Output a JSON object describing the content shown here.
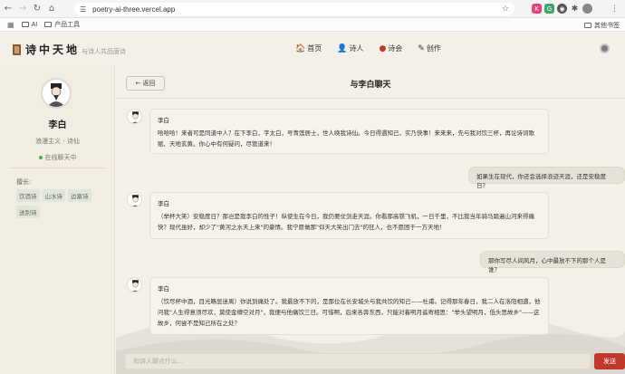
{
  "browser": {
    "url": "poetry-ai-three.vercel.app",
    "bookmarks": [
      {
        "label": "AI"
      },
      {
        "label": "产品工具"
      }
    ],
    "other_bookmarks": "其他书签",
    "extensions": [
      {
        "icon": "kagi-icon",
        "color": "#e0457b"
      },
      {
        "icon": "grammarly-icon",
        "color": "#3fa46a"
      },
      {
        "icon": "github-icon",
        "color": "#555555"
      },
      {
        "icon": "extension-icon",
        "color": "#777777"
      },
      {
        "icon": "profile-icon",
        "color": "#777777"
      }
    ]
  },
  "header": {
    "logo": "诗中天地",
    "tagline": "与诗人共品唐诗",
    "nav": [
      {
        "icon": "home-icon",
        "label": "首页"
      },
      {
        "icon": "poet-icon",
        "label": "诗人"
      },
      {
        "icon": "lantern-icon",
        "label": "诗会"
      },
      {
        "icon": "brush-icon",
        "label": "创作"
      }
    ]
  },
  "sidebar": {
    "name": "李白",
    "style": "浪漫主义 · 诗仙",
    "status": "在线聊天中",
    "skills_label": "擅长:",
    "tags": [
      "饮酒诗",
      "山水诗",
      "边塞诗",
      "送别诗"
    ]
  },
  "chat": {
    "back": "← 返回",
    "title": "与李白聊天",
    "messages": [
      {
        "role": "poet",
        "name": "李白",
        "text": "哈哈哈！来者可是同道中人？在下李白，字太白，号青莲居士，世人唤我诗仙。今日得遇知己，实乃快事！来来来，先与我对饮三杯，再论诗词歌赋、天地玄黄。你心中有何疑问，尽管道来！"
      },
      {
        "role": "user",
        "text": "如果生在现代，你还会选择浪迹天涯，还是安稳度日？"
      },
      {
        "role": "poet",
        "name": "李白",
        "text": "（举杯大笑）安稳度日？那岂是我李白的性子！纵使生在今日，我仍要仗剑走天涯。你看那高铁飞机，一日千里，不比我当年骑马踏遍山河来得痛快？现代虽好，却少了\"黄河之水天上来\"的豪情。我宁愿做那\"仰天大笑出门去\"的狂人，也不愿困于一方天地！"
      },
      {
        "role": "user",
        "text": "那你写尽人间风月，心中最放不下的那个人是谁？"
      },
      {
        "role": "poet",
        "name": "李白",
        "text": "（饮尽杯中酒，目光略显迷离）你说到痛处了。我最放不下的，是那位在长安城头与我共饮的知己——杜甫。记得那年春日，我二人在洛阳相遇，他问我\"人生得意须尽欢，莫使金樽空对月\"，我便与他痛饮三日。可惜啊，后来各奔东西，只能对着明月遥寄相思：\"举头望明月，低头思故乡\"——这故乡，何尝不是知己所在之处？"
      }
    ],
    "input_placeholder": "和诗人聊点什么...",
    "send": "发送"
  }
}
